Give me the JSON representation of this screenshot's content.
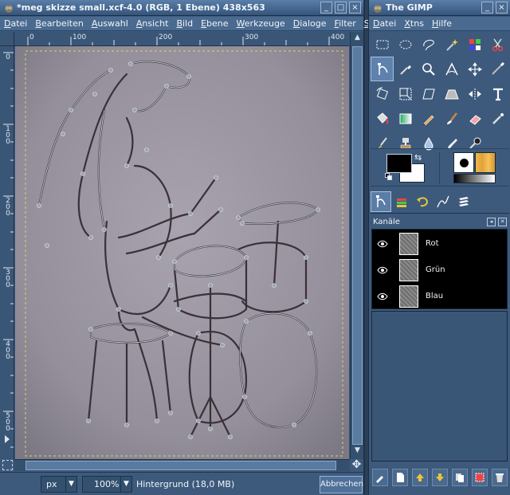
{
  "image_window": {
    "title": "*meg skizze small.xcf-4.0 (RGB, 1 Ebene) 438x563",
    "menu": [
      "Datei",
      "Bearbeiten",
      "Auswahl",
      "Ansicht",
      "Bild",
      "Ebene",
      "Werkzeuge",
      "Dialoge",
      "Filter",
      "Skript-Fu"
    ],
    "ruler_h_labels": [
      "0",
      "100",
      "200",
      "300",
      "400"
    ],
    "ruler_v_labels": [
      "0",
      "100",
      "200",
      "300",
      "400",
      "500"
    ],
    "status": {
      "unit": "px",
      "zoom": "100%",
      "layer_info": "Hintergrund (18,0 MB)",
      "cancel_label": "Abbrechen"
    },
    "window_buttons": [
      "_",
      "□",
      "×"
    ]
  },
  "toolbox": {
    "title": "The GIMP",
    "menu": [
      "Datei",
      "Xtns",
      "Hilfe"
    ],
    "tools": [
      "rect-select-icon",
      "ellipse-select-icon",
      "free-select-icon",
      "fuzzy-select-icon",
      "select-by-color-icon",
      "scissors-icon",
      "paths-icon",
      "color-picker-icon",
      "magnify-icon",
      "measure-icon",
      "move-icon",
      "crop-icon",
      "rotate-icon",
      "scale-icon",
      "shear-icon",
      "perspective-icon",
      "flip-icon",
      "text-icon",
      "bucket-fill-icon",
      "blend-icon",
      "pencil-icon",
      "paintbrush-icon",
      "eraser-icon",
      "airbrush-icon",
      "ink-icon",
      "clone-icon",
      "blur-icon",
      "smudge-icon",
      "dodge-burn-icon"
    ],
    "selected_tool": "paths-icon",
    "colors": {
      "foreground": "#000000",
      "background": "#ffffff"
    },
    "dock_tabs": [
      "paths-tab-icon",
      "layers-tab-icon",
      "undo-tab-icon",
      "paths-list-tab-icon",
      "channels-tab-icon"
    ],
    "dock_title": "Kanäle",
    "channels": [
      {
        "name": "Rot",
        "visible": true
      },
      {
        "name": "Grün",
        "visible": true
      },
      {
        "name": "Blau",
        "visible": true
      }
    ],
    "dock_buttons": [
      "edit-channel-icon",
      "new-channel-icon",
      "raise-channel-icon",
      "lower-channel-icon",
      "duplicate-channel-icon",
      "channel-to-selection-icon",
      "delete-channel-icon"
    ]
  }
}
